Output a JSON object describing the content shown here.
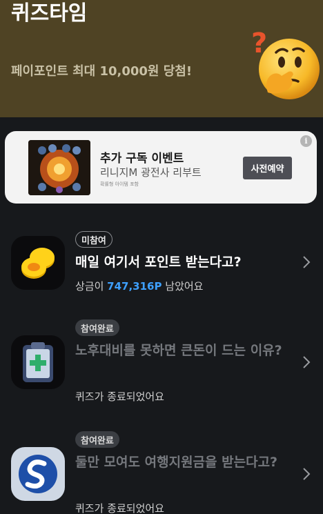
{
  "hero": {
    "title": "퀴즈타임",
    "subtitle": "페이포인트 최대 10,000원 당첨!",
    "icon": "thinking-face-icon",
    "bg_color": "#4f4324"
  },
  "ad": {
    "title": "추가 구독 이벤트",
    "subtitle": "리니지M 광전사 리부트",
    "disclaimer": "확률형 아이템 포함",
    "button_label": "사전예약",
    "info_label": "i"
  },
  "quizzes": [
    {
      "icon": "coins-icon",
      "status": "미참여",
      "title": "매일 여기서 포인트 받는다고?",
      "prize_prefix": "상금이 ",
      "prize_amount": "747,316P",
      "prize_suffix": " 남았어요"
    },
    {
      "icon": "clipboard-medical-icon",
      "status": "참여완료",
      "title": "노후대비를 못하면 큰돈이 드는 이유?",
      "sub": "퀴즈가 종료되었어요"
    },
    {
      "icon": "shinhan-logo-icon",
      "status": "참여완료",
      "title": "둘만 모여도 여행지원금을 받는다고?",
      "sub": "퀴즈가 종료되었어요"
    }
  ],
  "colors": {
    "accent": "#3ea0ff",
    "background": "#17191c"
  }
}
